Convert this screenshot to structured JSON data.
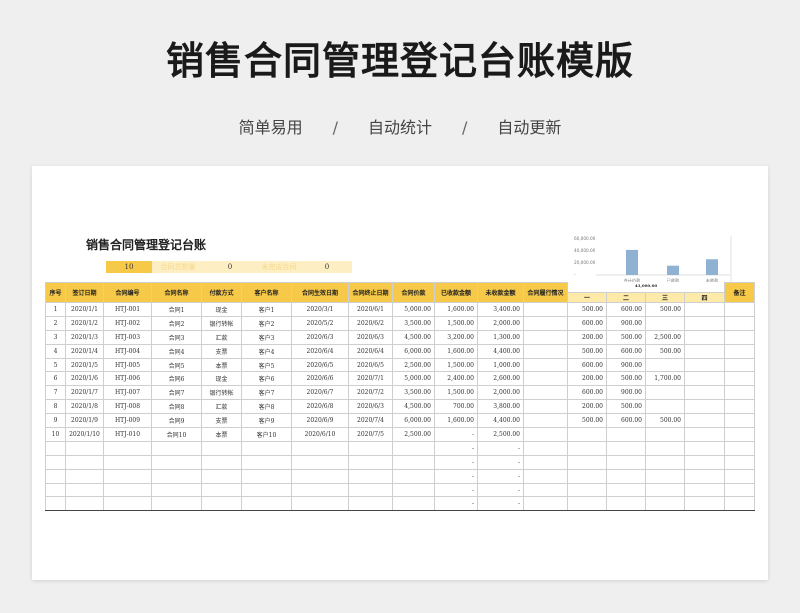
{
  "header": {
    "title": "销售合同管理登记台账模版",
    "features": [
      "简单易用",
      "自动统计",
      "自动更新"
    ],
    "separator": "/"
  },
  "sheet": {
    "title": "销售合同管理登记台账",
    "summary": {
      "value1": "10",
      "label1": "合同总数量",
      "value2": "0",
      "label2": "未完成合同",
      "value3": "0"
    },
    "mini_chart": {
      "ticks": [
        "60,000.00",
        "40,000.00",
        "20,000.00",
        "-"
      ],
      "top_label": "43,000.00",
      "categories": [
        "合计价款",
        "已收款",
        "未收款"
      ],
      "values": [
        43000,
        16000,
        27000
      ],
      "ymax": 60000,
      "bar_color": "#8fb2d3"
    },
    "columns": [
      "序号",
      "签订日期",
      "合同编号",
      "合同名称",
      "付款方式",
      "客户名称",
      "合同生效日期",
      "合同终止日期",
      "合同价款",
      "已收款金额",
      "未收款金额",
      "合同履行情况",
      "备注"
    ],
    "installments": [
      "一",
      "二",
      "三",
      "四"
    ],
    "rows": [
      [
        "1",
        "2020/1/1",
        "HTJ-001",
        "合同1",
        "现金",
        "客户1",
        "2020/3/1",
        "2020/6/1",
        "5,000.00",
        "1,600.00",
        "3,400.00",
        "",
        "500.00",
        "600.00",
        "500.00",
        "",
        ""
      ],
      [
        "2",
        "2020/1/2",
        "HTJ-002",
        "合同2",
        "银行转帐",
        "客户2",
        "2020/5/2",
        "2020/6/2",
        "3,500.00",
        "1,500.00",
        "2,000.00",
        "",
        "600.00",
        "900.00",
        "",
        "",
        ""
      ],
      [
        "3",
        "2020/1/3",
        "HTJ-003",
        "合同3",
        "汇款",
        "客户3",
        "2020/6/3",
        "2020/6/3",
        "4,500.00",
        "3,200.00",
        "1,300.00",
        "",
        "200.00",
        "500.00",
        "2,500.00",
        "",
        ""
      ],
      [
        "4",
        "2020/1/4",
        "HTJ-004",
        "合同4",
        "支票",
        "客户4",
        "2020/6/4",
        "2020/6/4",
        "6,000.00",
        "1,600.00",
        "4,400.00",
        "",
        "500.00",
        "600.00",
        "500.00",
        "",
        ""
      ],
      [
        "5",
        "2020/1/5",
        "HTJ-005",
        "合同5",
        "本票",
        "客户5",
        "2020/6/5",
        "2020/6/5",
        "2,500.00",
        "1,500.00",
        "1,000.00",
        "",
        "600.00",
        "900.00",
        "",
        "",
        ""
      ],
      [
        "6",
        "2020/1/6",
        "HTJ-006",
        "合同6",
        "现金",
        "客户6",
        "2020/6/6",
        "2020/7/1",
        "5,000.00",
        "2,400.00",
        "2,600.00",
        "",
        "200.00",
        "500.00",
        "1,700.00",
        "",
        ""
      ],
      [
        "7",
        "2020/1/7",
        "HTJ-007",
        "合同7",
        "银行转帐",
        "客户7",
        "2020/6/7",
        "2020/7/2",
        "3,500.00",
        "1,500.00",
        "2,000.00",
        "",
        "600.00",
        "900.00",
        "",
        "",
        ""
      ],
      [
        "8",
        "2020/1/8",
        "HTJ-008",
        "合同8",
        "汇款",
        "客户8",
        "2020/6/8",
        "2020/6/3",
        "4,500.00",
        "700.00",
        "3,800.00",
        "",
        "200.00",
        "500.00",
        "",
        "",
        ""
      ],
      [
        "9",
        "2020/1/9",
        "HTJ-009",
        "合同9",
        "支票",
        "客户9",
        "2020/6/9",
        "2020/7/4",
        "6,000.00",
        "1,600.00",
        "4,400.00",
        "",
        "500.00",
        "600.00",
        "500.00",
        "",
        ""
      ],
      [
        "10",
        "2020/1/10",
        "HTJ-010",
        "合同10",
        "本票",
        "客户10",
        "2020/6/10",
        "2020/7/5",
        "2,500.00",
        "-",
        "2,500.00",
        "",
        "",
        "",
        "",
        "",
        ""
      ],
      [
        "",
        "",
        "",
        "",
        "",
        "",
        "",
        "",
        "",
        "-",
        "-",
        "",
        "",
        "",
        "",
        "",
        ""
      ],
      [
        "",
        "",
        "",
        "",
        "",
        "",
        "",
        "",
        "",
        "-",
        "-",
        "",
        "",
        "",
        "",
        "",
        ""
      ],
      [
        "",
        "",
        "",
        "",
        "",
        "",
        "",
        "",
        "",
        "-",
        "-",
        "",
        "",
        "",
        "",
        "",
        ""
      ],
      [
        "",
        "",
        "",
        "",
        "",
        "",
        "",
        "",
        "",
        "-",
        "-",
        "",
        "",
        "",
        "",
        "",
        ""
      ],
      [
        "",
        "",
        "",
        "",
        "",
        "",
        "",
        "",
        "",
        "-",
        "-",
        "",
        "",
        "",
        "",
        "",
        ""
      ]
    ]
  }
}
